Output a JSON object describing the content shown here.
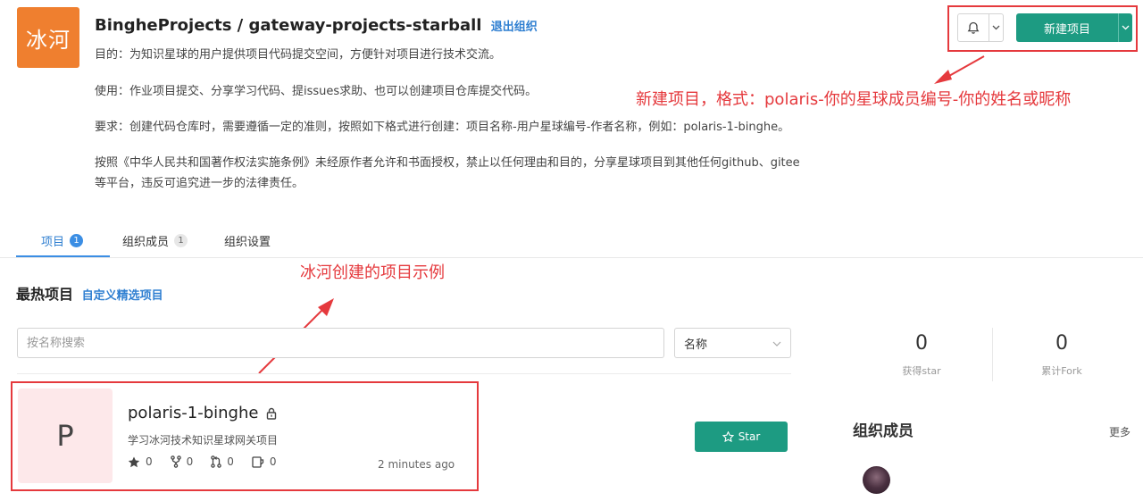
{
  "org": {
    "avatar_text": "冰河",
    "title": "BingheProjects / gateway-projects-starball",
    "leave_label": "退出组织",
    "desc_1": "目的：为知识星球的用户提供项目代码提交空间，方便针对项目进行技术交流。",
    "desc_2": "使用：作业项目提交、分享学习代码、提issues求助、也可以创建项目仓库提交代码。",
    "desc_3": "要求：创建代码仓库时，需要遵循一定的准则，按照如下格式进行创建：项目名称-用户星球编号-作者名称，例如：polaris-1-binghe。",
    "desc_4a": "按照《中华人民共和国著作权法实施条例》未经原作者允许和书面授权，禁止以任何理由和目的，分享星球项目到其他任何github、gitee",
    "desc_4b": "等平台，违反可追究进一步的法律责任。"
  },
  "header_actions": {
    "new_project_label": "新建项目"
  },
  "annotations": {
    "new_project_note": "新建项目，格式：polaris-你的星球成员编号-你的姓名或昵称",
    "example_note": "冰河创建的项目示例"
  },
  "tabs": [
    {
      "label": "项目",
      "count": "1"
    },
    {
      "label": "组织成员",
      "count": "1"
    },
    {
      "label": "组织设置"
    }
  ],
  "projects_section": {
    "title": "最热项目",
    "custom_label": "自定义精选项目",
    "search_placeholder": "按名称搜索",
    "sort_label": "名称"
  },
  "project": {
    "avatar_letter": "P",
    "name": "polaris-1-binghe",
    "description": "学习冰河技术知识星球网关项目",
    "stars": "0",
    "forks": "0",
    "pull_requests": "0",
    "issues": "0",
    "updated": "2 minutes ago",
    "star_button_label": "Star"
  },
  "sidebar": {
    "stars_count": "0",
    "stars_label": "获得star",
    "forks_count": "0",
    "forks_label": "累计Fork",
    "members_title": "组织成员",
    "more_label": "更多"
  },
  "colors": {
    "accent_green": "#1d9b82",
    "link_blue": "#2f7fd1",
    "annotation_red": "#e5393d",
    "org_avatar_orange": "#ef7f2f"
  }
}
